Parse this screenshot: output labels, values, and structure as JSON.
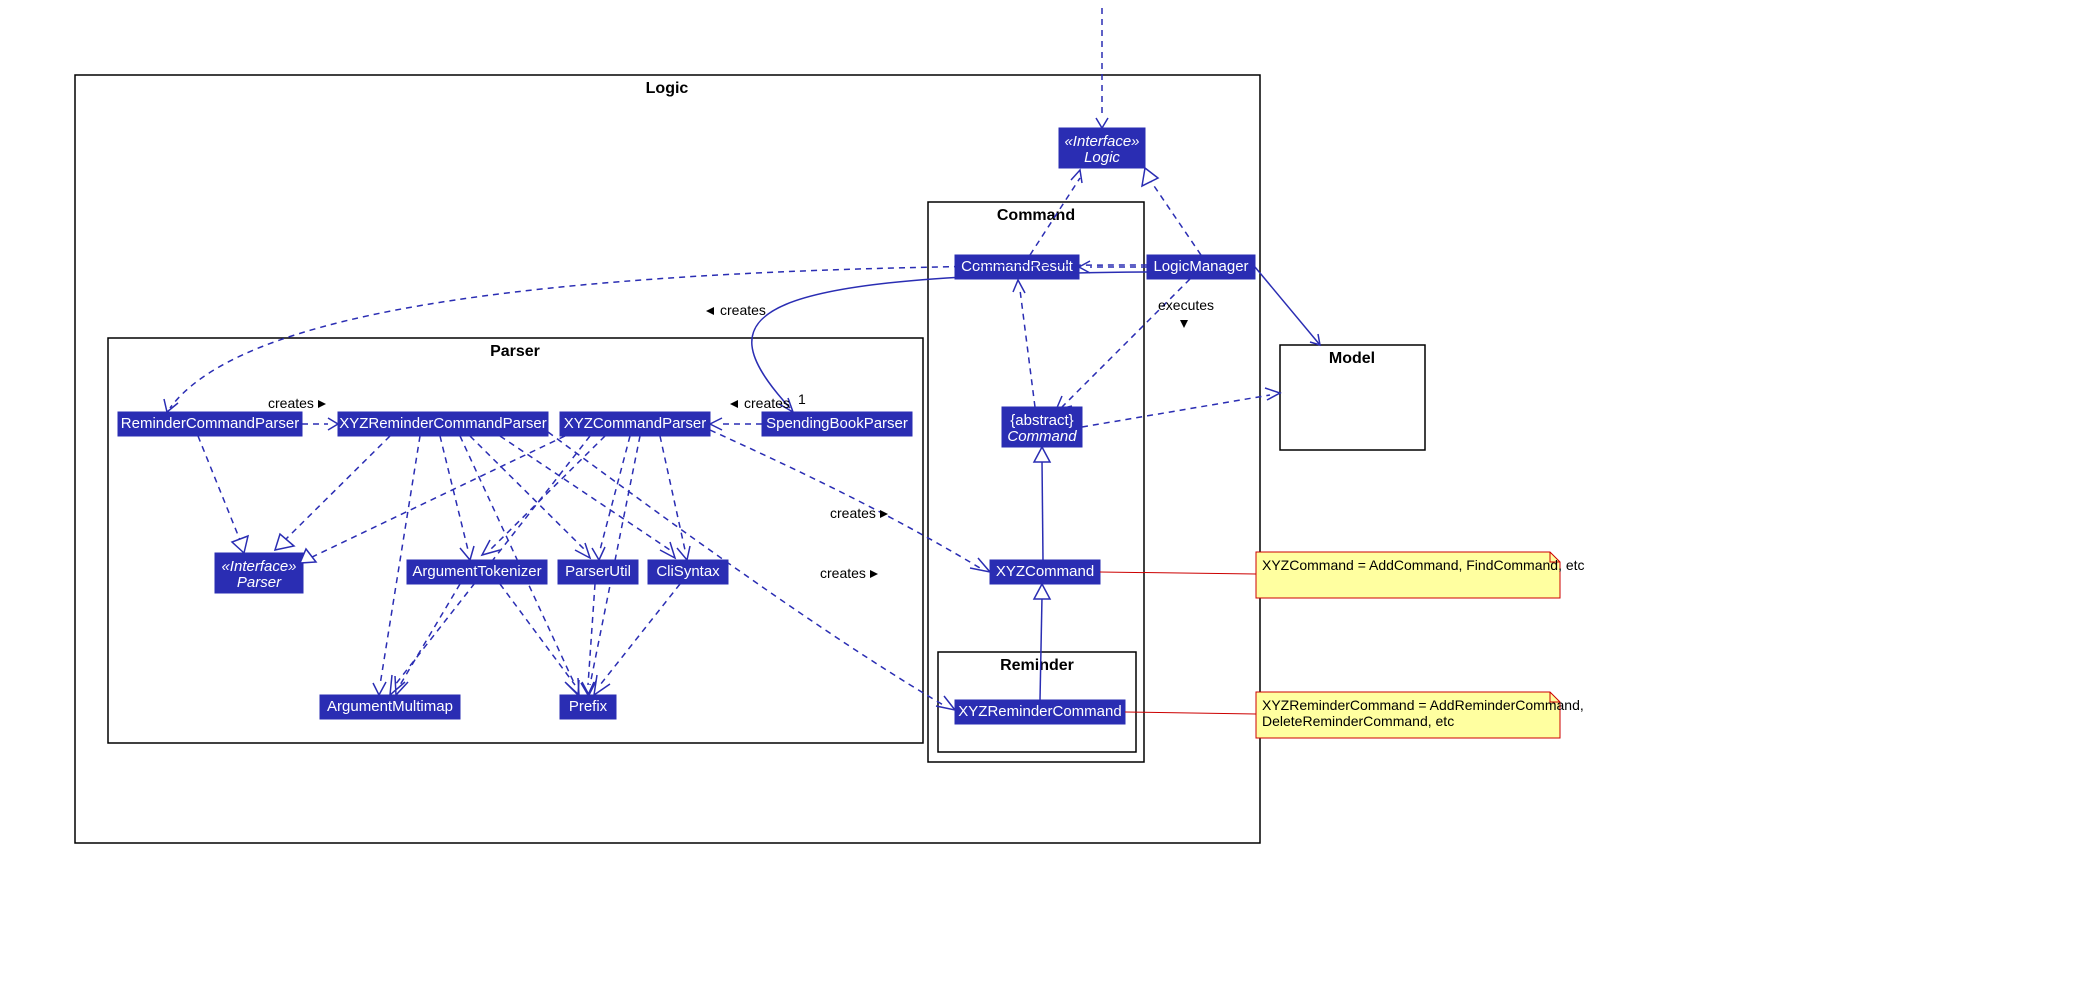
{
  "packages": {
    "logic": "Logic",
    "command": "Command",
    "parser": "Parser",
    "reminder": "Reminder",
    "model": "Model"
  },
  "classes": {
    "interfaceLogic_stereo": "«Interface»",
    "interfaceLogic_name": "Logic",
    "commandResult": "CommandResult",
    "logicManager": "LogicManager",
    "abstractCommand_stereo": "{abstract}",
    "abstractCommand_name": "Command",
    "xyzCommand": "XYZCommand",
    "xyzReminderCommand": "XYZReminderCommand",
    "reminderCommandParser": "ReminderCommandParser",
    "xyzReminderCommandParser": "XYZReminderCommandParser",
    "xyzCommandParser": "XYZCommandParser",
    "spendingBookParser": "SpendingBookParser",
    "interfaceParser_stereo": "«Interface»",
    "interfaceParser_name": "Parser",
    "argumentTokenizer": "ArgumentTokenizer",
    "parserUtil": "ParserUtil",
    "cliSyntax": "CliSyntax",
    "argumentMultimap": "ArgumentMultimap",
    "prefix": "Prefix"
  },
  "labels": {
    "creates": "creates",
    "executes": "executes",
    "one": "1"
  },
  "notes": {
    "xyzCmdNote": "XYZCommand = AddCommand, FindCommand, etc",
    "xyzRemNote": "XYZReminderCommand = AddReminderCommand, DeleteReminderCommand, etc"
  }
}
